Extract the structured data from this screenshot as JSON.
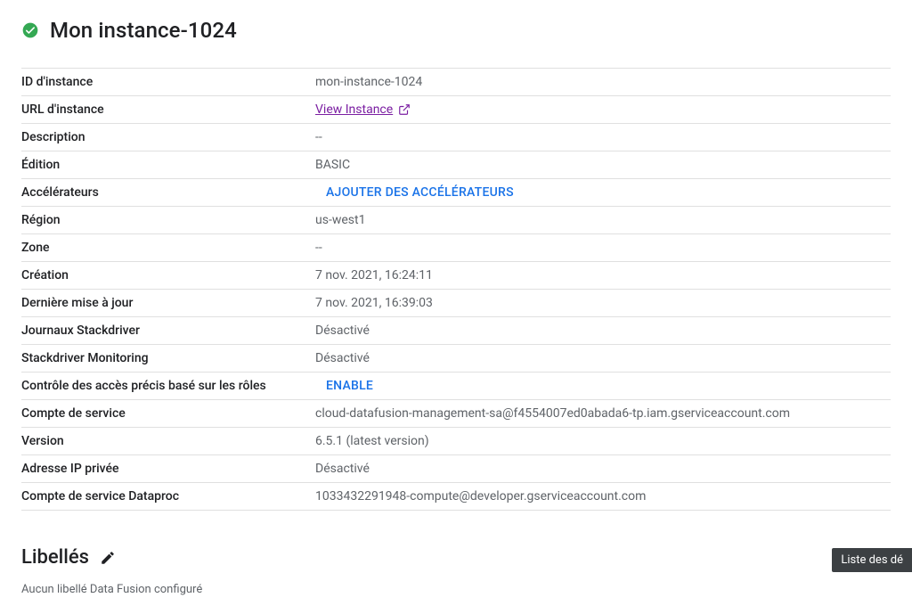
{
  "header": {
    "title": "Mon instance-1024"
  },
  "details": {
    "instance_id": {
      "label": "ID d'instance",
      "value": "mon-instance-1024"
    },
    "instance_url": {
      "label": "URL d'instance",
      "link_text": "View Instance"
    },
    "description": {
      "label": "Description",
      "value": "--"
    },
    "edition": {
      "label": "Édition",
      "value": "BASIC"
    },
    "accelerators": {
      "label": "Accélérateurs",
      "action": "AJOUTER DES ACCÉLÉRATEURS"
    },
    "region": {
      "label": "Région",
      "value": "us-west1"
    },
    "zone": {
      "label": "Zone",
      "value": "--"
    },
    "creation": {
      "label": "Création",
      "value": "7 nov. 2021, 16:24:11"
    },
    "last_update": {
      "label": "Dernière mise à jour",
      "value": "7 nov. 2021, 16:39:03"
    },
    "stackdriver_logs": {
      "label": "Journaux Stackdriver",
      "value": "Désactivé"
    },
    "stackdriver_monitoring": {
      "label": "Stackdriver Monitoring",
      "value": "Désactivé"
    },
    "rbac": {
      "label": "Contrôle des accès précis basé sur les rôles",
      "action": "ENABLE"
    },
    "service_account": {
      "label": "Compte de service",
      "value": "cloud-datafusion-management-sa@f4554007ed0abada6-tp.iam.gserviceaccount.com"
    },
    "version": {
      "label": "Version",
      "value": "6.5.1 (latest version)"
    },
    "private_ip": {
      "label": "Adresse IP privée",
      "value": "Désactivé"
    },
    "dataproc_service_account": {
      "label": "Compte de service Dataproc",
      "value": "1033432291948-compute@developer.gserviceaccount.com"
    }
  },
  "labels_section": {
    "title": "Libellés",
    "empty_message": "Aucun libellé Data Fusion configuré"
  },
  "floating": {
    "text": "Liste des dé"
  }
}
